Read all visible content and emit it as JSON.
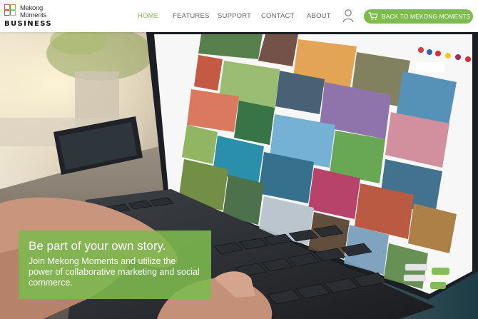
{
  "brand": {
    "line1": "Mekong",
    "line2": "Moments",
    "business": "BUSINESS",
    "colors": [
      "#e94e3c",
      "#7dba4f",
      "#3b8ad9",
      "#f2b33d"
    ]
  },
  "nav": {
    "items": [
      {
        "label": "HOME",
        "active": true
      },
      {
        "label": "FEATURES",
        "active": false
      },
      {
        "label": "SUPPORT",
        "active": false
      },
      {
        "label": "CONTACT",
        "active": false
      },
      {
        "label": "ABOUT",
        "active": false
      }
    ],
    "account_icon": "user-icon",
    "back_button": {
      "label": "BACK TO MEKONG MOMENTS",
      "icon": "cart-icon"
    }
  },
  "hero": {
    "title": "Be part of your own story.",
    "text": "Join Mekong Moments and utilize the power of collaborative marketing and social commerce."
  },
  "colors": {
    "accent": "#7dba4f",
    "nav_text": "#666666"
  }
}
